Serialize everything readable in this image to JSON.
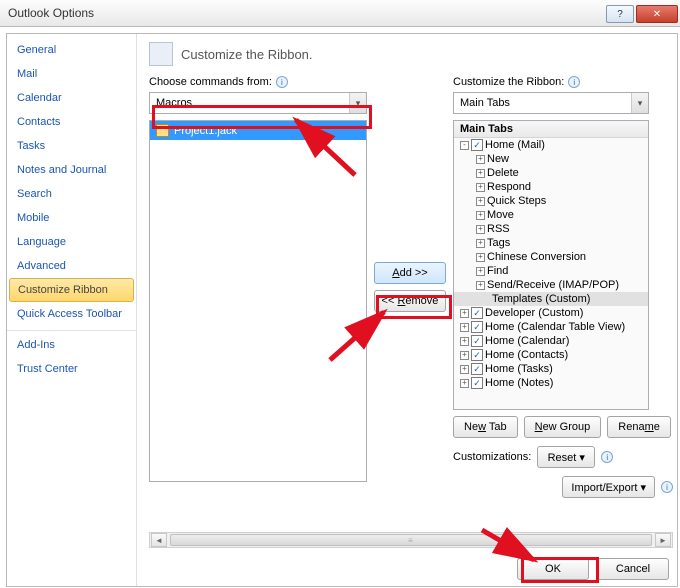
{
  "window": {
    "title": "Outlook Options"
  },
  "sidebar": {
    "items": [
      {
        "label": "General"
      },
      {
        "label": "Mail"
      },
      {
        "label": "Calendar"
      },
      {
        "label": "Contacts"
      },
      {
        "label": "Tasks"
      },
      {
        "label": "Notes and Journal"
      },
      {
        "label": "Search"
      },
      {
        "label": "Mobile"
      },
      {
        "label": "Language"
      },
      {
        "label": "Advanced"
      },
      {
        "label": "Customize Ribbon"
      },
      {
        "label": "Quick Access Toolbar"
      },
      {
        "label": "Add-Ins"
      },
      {
        "label": "Trust Center"
      }
    ],
    "active_index": 10
  },
  "content": {
    "heading": "Customize the Ribbon.",
    "left": {
      "label": "Choose commands from:",
      "combo": "Macros",
      "list": [
        {
          "label": "Project1.jack",
          "selected": true
        }
      ]
    },
    "mid": {
      "add": "Add >>",
      "remove": "<< Remove"
    },
    "right": {
      "label": "Customize the Ribbon:",
      "combo": "Main Tabs",
      "tree_header": "Main Tabs",
      "tree": [
        {
          "lvl": 1,
          "toggle": "-",
          "cb": true,
          "label": "Home (Mail)"
        },
        {
          "lvl": 2,
          "toggle": "+",
          "label": "New"
        },
        {
          "lvl": 2,
          "toggle": "+",
          "label": "Delete"
        },
        {
          "lvl": 2,
          "toggle": "+",
          "label": "Respond"
        },
        {
          "lvl": 2,
          "toggle": "+",
          "label": "Quick Steps"
        },
        {
          "lvl": 2,
          "toggle": "+",
          "label": "Move"
        },
        {
          "lvl": 2,
          "toggle": "+",
          "label": "RSS"
        },
        {
          "lvl": 2,
          "toggle": "+",
          "label": "Tags"
        },
        {
          "lvl": 2,
          "toggle": "+",
          "label": "Chinese Conversion"
        },
        {
          "lvl": 2,
          "toggle": "+",
          "label": "Find"
        },
        {
          "lvl": 2,
          "toggle": "+",
          "label": "Send/Receive (IMAP/POP)"
        },
        {
          "lvl": 3,
          "sel": true,
          "label": "Templates (Custom)"
        },
        {
          "lvl": 1,
          "toggle": "+",
          "cb": true,
          "label": "Developer (Custom)"
        },
        {
          "lvl": 1,
          "toggle": "+",
          "cb": true,
          "label": "Home (Calendar Table View)"
        },
        {
          "lvl": 1,
          "toggle": "+",
          "cb": true,
          "label": "Home (Calendar)"
        },
        {
          "lvl": 1,
          "toggle": "+",
          "cb": true,
          "label": "Home (Contacts)"
        },
        {
          "lvl": 1,
          "toggle": "+",
          "cb": true,
          "label": "Home (Tasks)"
        },
        {
          "lvl": 1,
          "toggle": "+",
          "cb": true,
          "label": "Home (Notes)"
        }
      ],
      "buttons": {
        "new_tab": "New Tab",
        "new_group": "New Group",
        "rename": "Rename"
      },
      "customizations_label": "Customizations:",
      "reset": "Reset ▾",
      "import_export": "Import/Export ▾"
    }
  },
  "footer": {
    "ok": "OK",
    "cancel": "Cancel"
  }
}
